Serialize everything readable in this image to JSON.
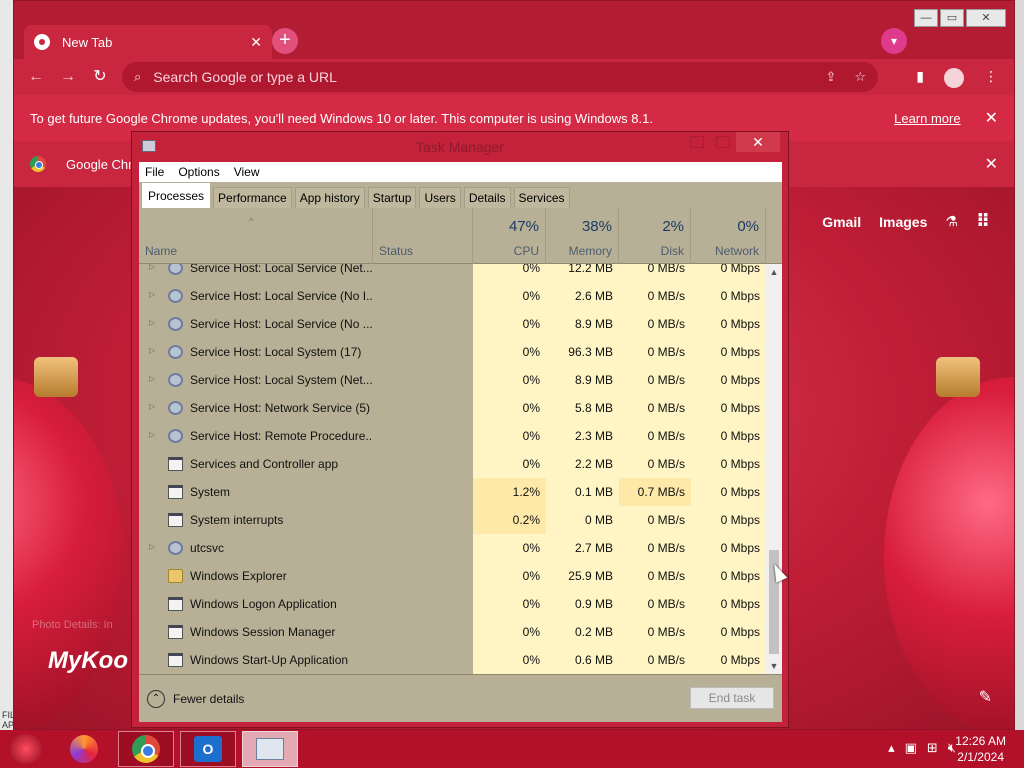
{
  "chrome": {
    "tab_title": "New Tab",
    "omnibox_placeholder": "Search Google or type a URL",
    "infobar_message": "To get future Google Chrome updates, you'll need Windows 10 or later. This computer is using Windows 8.1.",
    "infobar_link": "Learn more",
    "infobar2_text": "Google Chr",
    "ntp_links": [
      "Gmail",
      "Images"
    ],
    "brand_text": "MyKoo",
    "brand_faded": "Photo Details: In"
  },
  "taskmgr": {
    "title": "Task Manager",
    "menu": [
      "File",
      "Options",
      "View"
    ],
    "tabs": [
      "Processes",
      "Performance",
      "App history",
      "Startup",
      "Users",
      "Details",
      "Services"
    ],
    "active_tab": "Processes",
    "headers": {
      "name": "Name",
      "status": "Status",
      "cpu_pct": "47%",
      "cpu": "CPU",
      "mem_pct": "38%",
      "mem": "Memory",
      "disk_pct": "2%",
      "disk": "Disk",
      "net_pct": "0%",
      "net": "Network"
    },
    "rows": [
      {
        "name": "Service Host: Local Service (Net...",
        "cpu": "0%",
        "mem": "12.2 MB",
        "disk": "0 MB/s",
        "net": "0 Mbps"
      },
      {
        "name": "Service Host: Local Service (No I...",
        "cpu": "0%",
        "mem": "2.6 MB",
        "disk": "0 MB/s",
        "net": "0 Mbps"
      },
      {
        "name": "Service Host: Local Service (No ...",
        "cpu": "0%",
        "mem": "8.9 MB",
        "disk": "0 MB/s",
        "net": "0 Mbps"
      },
      {
        "name": "Service Host: Local System (17)",
        "cpu": "0%",
        "mem": "96.3 MB",
        "disk": "0 MB/s",
        "net": "0 Mbps"
      },
      {
        "name": "Service Host: Local System (Net...",
        "cpu": "0%",
        "mem": "8.9 MB",
        "disk": "0 MB/s",
        "net": "0 Mbps"
      },
      {
        "name": "Service Host: Network Service (5)",
        "cpu": "0%",
        "mem": "5.8 MB",
        "disk": "0 MB/s",
        "net": "0 Mbps"
      },
      {
        "name": "Service Host: Remote Procedure...",
        "cpu": "0%",
        "mem": "2.3 MB",
        "disk": "0 MB/s",
        "net": "0 Mbps"
      },
      {
        "name": "Services and Controller app",
        "cpu": "0%",
        "mem": "2.2 MB",
        "disk": "0 MB/s",
        "net": "0 Mbps"
      },
      {
        "name": "System",
        "cpu": "1.2%",
        "mem": "0.1 MB",
        "disk": "0.7 MB/s",
        "net": "0 Mbps"
      },
      {
        "name": "System interrupts",
        "cpu": "0.2%",
        "mem": "0 MB",
        "disk": "0 MB/s",
        "net": "0 Mbps"
      },
      {
        "name": "utcsvc",
        "cpu": "0%",
        "mem": "2.7 MB",
        "disk": "0 MB/s",
        "net": "0 Mbps"
      },
      {
        "name": "Windows Explorer",
        "cpu": "0%",
        "mem": "25.9 MB",
        "disk": "0 MB/s",
        "net": "0 Mbps"
      },
      {
        "name": "Windows Logon Application",
        "cpu": "0%",
        "mem": "0.9 MB",
        "disk": "0 MB/s",
        "net": "0 Mbps"
      },
      {
        "name": "Windows Session Manager",
        "cpu": "0%",
        "mem": "0.2 MB",
        "disk": "0 MB/s",
        "net": "0 Mbps"
      },
      {
        "name": "Windows Start-Up Application",
        "cpu": "0%",
        "mem": "0.6 MB",
        "disk": "0 MB/s",
        "net": "0 Mbps"
      }
    ],
    "fewer_details": "Fewer details",
    "end_task": "End task"
  },
  "taskbar": {
    "time": "12:26 AM",
    "date": "2/1/2024",
    "left_strip_label": "FILTER APPLIED"
  },
  "colors": {
    "chrome_theme": "#c4213a",
    "taskmgr_bg": "#b7b096",
    "cell_highlight": "#fff4c4"
  }
}
